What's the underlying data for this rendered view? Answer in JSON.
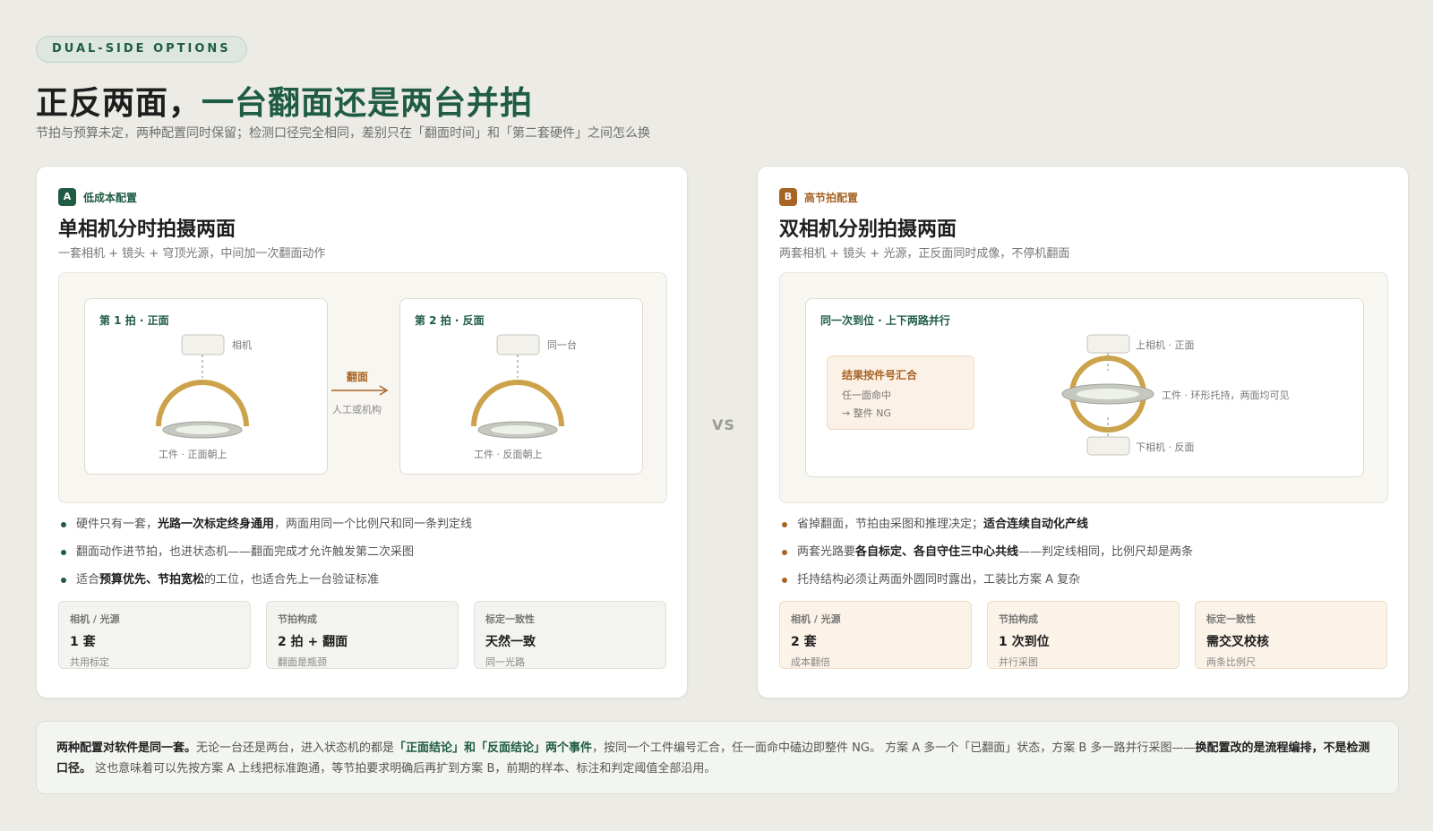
{
  "header": {
    "tag": "DUAL-SIDE OPTIONS",
    "title_part1": "正反两面，",
    "title_part2": "一台翻面还是两台并拍",
    "subtitle": "节拍与预算未定，两种配置同时保留；检测口径完全相同，差别只在「翻面时间」和「第二套硬件」之间怎么换"
  },
  "option_a": {
    "badge": "A",
    "badge_label": "低成本配置",
    "title": "单相机分时拍摄两面",
    "subtitle": "一套相机 + 镜头 + 穹顶光源，中间加一次翻面动作",
    "shot1": {
      "title": "第 1 拍 · 正面",
      "camera_label": "相机",
      "workpiece_label": "工件 · 正面朝上"
    },
    "flip": {
      "title": "翻面",
      "sub": "人工或机构"
    },
    "shot2": {
      "title": "第 2 拍 · 反面",
      "camera_label": "同一台",
      "workpiece_label": "工件 · 反面朝上"
    },
    "bullets": [
      {
        "pre": "硬件只有一套，",
        "bold": "光路一次标定终身通用",
        "post": "，两面用同一个比例尺和同一条判定线"
      },
      {
        "pre": "翻面动作进节拍，也进状态机——翻面完成才允许触发第二次采图",
        "bold": "",
        "post": ""
      },
      {
        "pre": "适合",
        "bold": "预算优先、节拍宽松",
        "post": "的工位，也适合先上一台验证标准"
      }
    ],
    "stats": [
      {
        "label": "相机 / 光源",
        "value": "1 套",
        "note": "共用标定"
      },
      {
        "label": "节拍构成",
        "value": "2 拍 + 翻面",
        "note": "翻面是瓶颈"
      },
      {
        "label": "标定一致性",
        "value": "天然一致",
        "note": "同一光路"
      }
    ]
  },
  "vs": "VS",
  "option_b": {
    "badge": "B",
    "badge_label": "高节拍配置",
    "title": "双相机分别拍摄两面",
    "subtitle": "两套相机 + 镜头 + 光源，正反面同时成像，不停机翻面",
    "diagram": {
      "title": "同一次到位 · 上下两路并行",
      "result_title": "结果按件号汇合",
      "result_line1": "任一面命中",
      "result_line2": "→ 整件 NG",
      "top_camera_label": "上相机 · 正面",
      "workpiece_label": "工件 · 环形托持，两面均可见",
      "bottom_camera_label": "下相机 · 反面"
    },
    "bullets": [
      {
        "pre": "省掉翻面，节拍由采图和推理决定；",
        "bold": "适合连续自动化产线",
        "post": ""
      },
      {
        "pre": "两套光路要",
        "bold": "各自标定、各自守住三中心共线",
        "post": "——判定线相同，比例尺却是两条"
      },
      {
        "pre": "托持结构必须让两面外圆同时露出，工装比方案 A 复杂",
        "bold": "",
        "post": ""
      }
    ],
    "stats": [
      {
        "label": "相机 / 光源",
        "value": "2 套",
        "note": "成本翻倍"
      },
      {
        "label": "节拍构成",
        "value": "1 次到位",
        "note": "并行采图"
      },
      {
        "label": "标定一致性",
        "value": "需交叉校核",
        "note": "两条比例尺"
      }
    ]
  },
  "footer": {
    "s1": "两种配置对软件是同一套。",
    "s2": "无论一台还是两台，进入状态机的都是",
    "s3": "「正面结论」和「反面结论」两个事件",
    "s4": "，按同一个工件编号汇合，任一面命中磕边即整件 NG。 方案 A 多一个「已翻面」状态，方案 B 多一路并行采图——",
    "s5": "换配置改的是流程编排，不是检测口径。",
    "s6": " 这也意味着可以先按方案 A 上线把标准跑通，等节拍要求明确后再扩到方案 B，前期的样本、标注和判定阈值全部沿用。"
  },
  "colors": {
    "green": "#1f5c43",
    "brown": "#a86424",
    "gold": "#cca24a",
    "background": "#ecebe6"
  }
}
